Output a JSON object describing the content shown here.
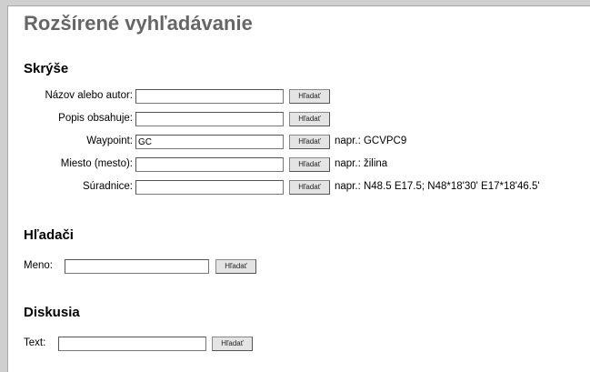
{
  "page": {
    "title": "Rozšírené vyhľadávanie"
  },
  "caches": {
    "title": "Skrýše",
    "search_label": "Hľadať",
    "rows": [
      {
        "label": "Názov alebo autor:",
        "value": "",
        "hint": ""
      },
      {
        "label": "Popis obsahuje:",
        "value": "",
        "hint": ""
      },
      {
        "label": "Waypoint:",
        "value": "GC",
        "hint": "napr.: GCVPC9"
      },
      {
        "label": "Miesto (mesto):",
        "value": "",
        "hint": "napr.: žilina"
      },
      {
        "label": "Súradnice:",
        "value": "",
        "hint": "napr.: N48.5 E17.5; N48*18'30' E17*18'46.5'"
      }
    ]
  },
  "finders": {
    "title": "Hľadači",
    "label": "Meno:",
    "value": "",
    "search_label": "Hľadať"
  },
  "discussion": {
    "title": "Diskusia",
    "label": "Text:",
    "value": "",
    "search_label": "Hľadať"
  }
}
